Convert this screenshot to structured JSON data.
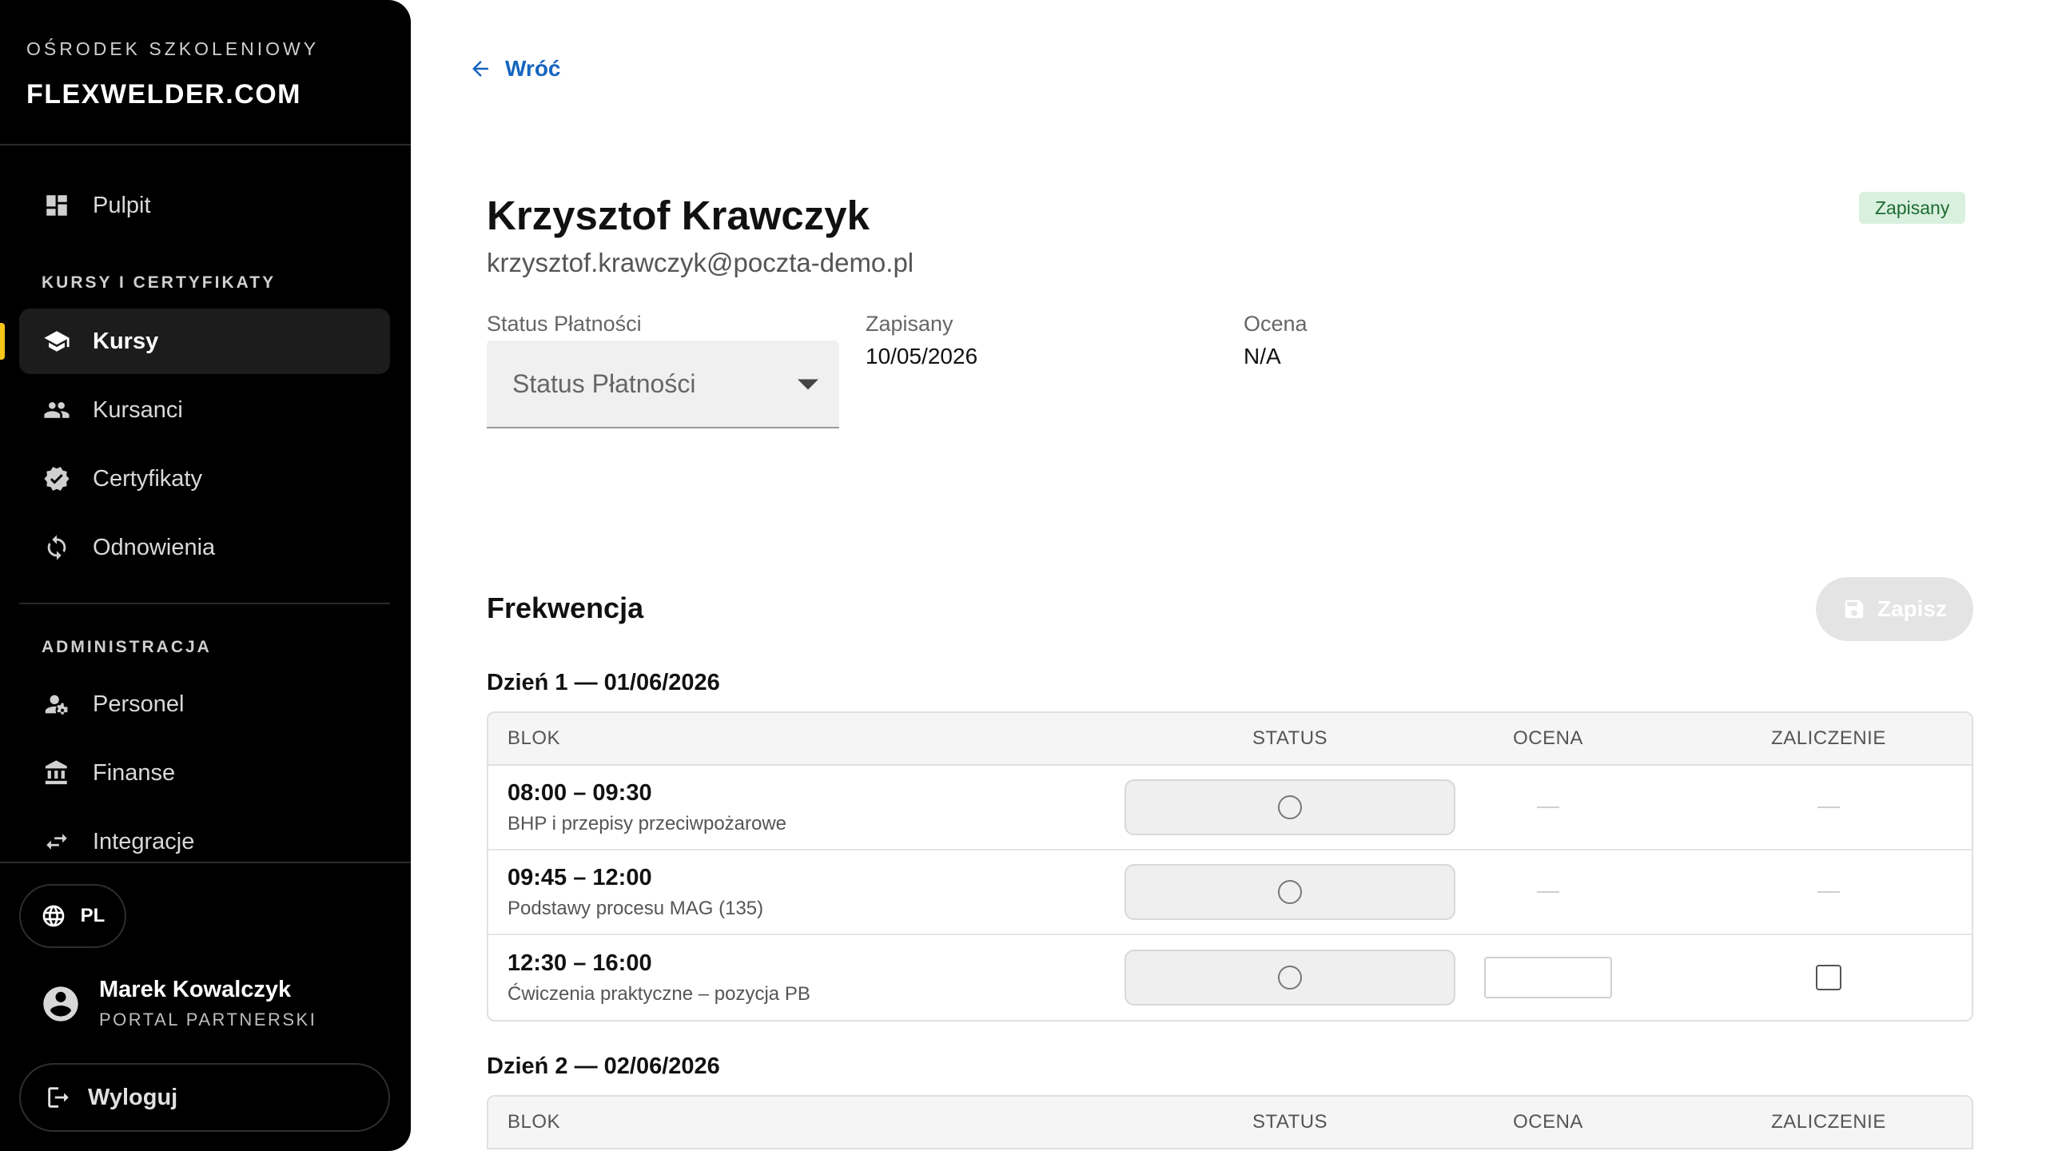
{
  "sidebar": {
    "brand_subtitle": "OŚRODEK SZKOLENIOWY",
    "brand_logo": "FLEXWELDER.COM",
    "dashboard_label": "Pulpit",
    "section_courses": "KURSY I CERTYFIKATY",
    "courses_label": "Kursy",
    "students_label": "Kursanci",
    "certificates_label": "Certyfikaty",
    "renewals_label": "Odnowienia",
    "section_admin": "ADMINISTRACJA",
    "staff_label": "Personel",
    "finance_label": "Finanse",
    "integrations_label": "Integracje",
    "language": "PL",
    "user_name": "Marek Kowalczyk",
    "user_role": "PORTAL PARTNERSKI",
    "logout_label": "Wyloguj",
    "accent_color": "#f5c518"
  },
  "main": {
    "back_label": "Wróć",
    "student_name": "Krzysztof Krawczyk",
    "student_email": "krzysztof.krawczyk@poczta-demo.pl",
    "status_badge": "Zapisany",
    "payment_label": "Status Płatności",
    "payment_placeholder": "Status Płatności",
    "enrolled_label": "Zapisany",
    "enrolled_date": "10/05/2026",
    "grade_label": "Ocena",
    "grade_value": "N/A",
    "attendance_title": "Frekwencja",
    "save_label": "Zapisz",
    "columns": {
      "block": "BLOK",
      "status": "STATUS",
      "grade": "OCENA",
      "pass": "ZALICZENIE"
    },
    "days": [
      {
        "title": "Dzień 1 — 01/06/2026",
        "rows": [
          {
            "time": "08:00 – 09:30",
            "topic": "BHP i przepisy przeciwpożarowe"
          },
          {
            "time": "09:45 – 12:00",
            "topic": "Podstawy procesu MAG (135)"
          },
          {
            "time": "12:30 – 16:00",
            "topic": "Ćwiczenia praktyczne – pozycja PB"
          }
        ]
      },
      {
        "title": "Dzień 2 — 02/06/2026",
        "rows": []
      }
    ]
  }
}
